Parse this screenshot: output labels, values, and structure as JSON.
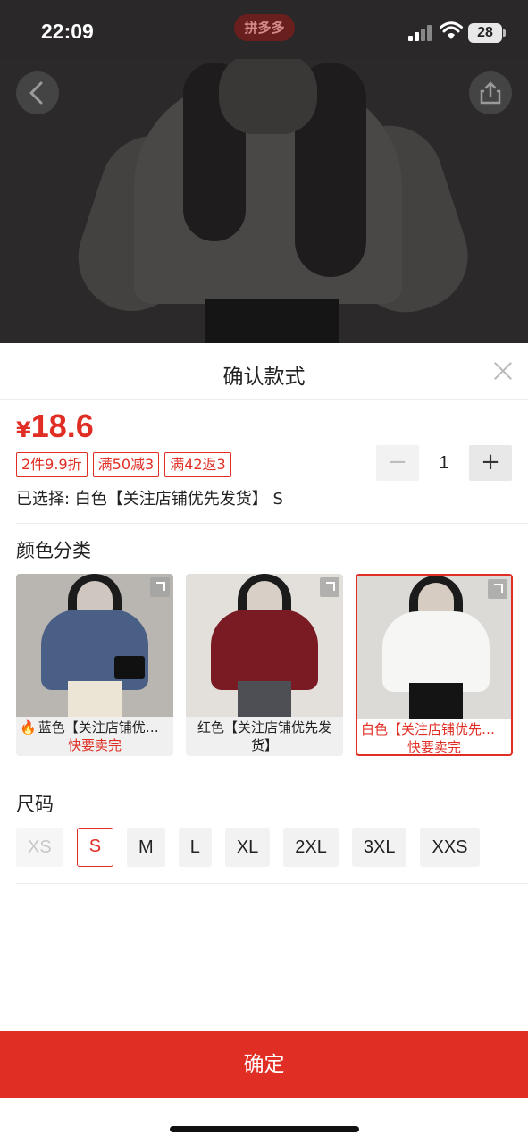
{
  "status_bar": {
    "time": "22:09",
    "app_logo_text": "拼多多",
    "battery": "28",
    "icons": [
      "signal-icon",
      "wifi-icon",
      "battery-icon"
    ]
  },
  "top_nav": {
    "back_icon": "chevron-left-icon",
    "share_icon": "share-icon"
  },
  "sheet": {
    "title": "确认款式",
    "close_icon": "close-icon",
    "price": {
      "currency": "¥",
      "value": "18.6"
    },
    "promo_tags": [
      "2件9.9折",
      "满50减3",
      "满42返3"
    ],
    "quantity": {
      "minus": "−",
      "value": "1",
      "plus": "+"
    },
    "selected_text": "已选择: 白色【关注店铺优先发货】 S",
    "color_section_title": "颜色分类",
    "colors": [
      {
        "name": "蓝色【关注店铺优先发货】",
        "sub": "快要卖完",
        "hot_icon": "flame-icon"
      },
      {
        "name": "红色【关注店铺优先发货】",
        "sub": ""
      },
      {
        "name": "白色【关注店铺优先发货】",
        "sub": "快要卖完",
        "selected": true
      }
    ],
    "size_section_title": "尺码",
    "sizes": [
      {
        "label": "XS",
        "state": "disabled"
      },
      {
        "label": "S",
        "state": "selected"
      },
      {
        "label": "M",
        "state": "normal"
      },
      {
        "label": "L",
        "state": "normal"
      },
      {
        "label": "XL",
        "state": "normal"
      },
      {
        "label": "2XL",
        "state": "normal"
      },
      {
        "label": "3XL",
        "state": "normal"
      },
      {
        "label": "XXS",
        "state": "normal"
      }
    ],
    "confirm_label": "确定"
  },
  "colors": {
    "accent": "#e02e24",
    "overlay_bg": "#2b2929"
  }
}
